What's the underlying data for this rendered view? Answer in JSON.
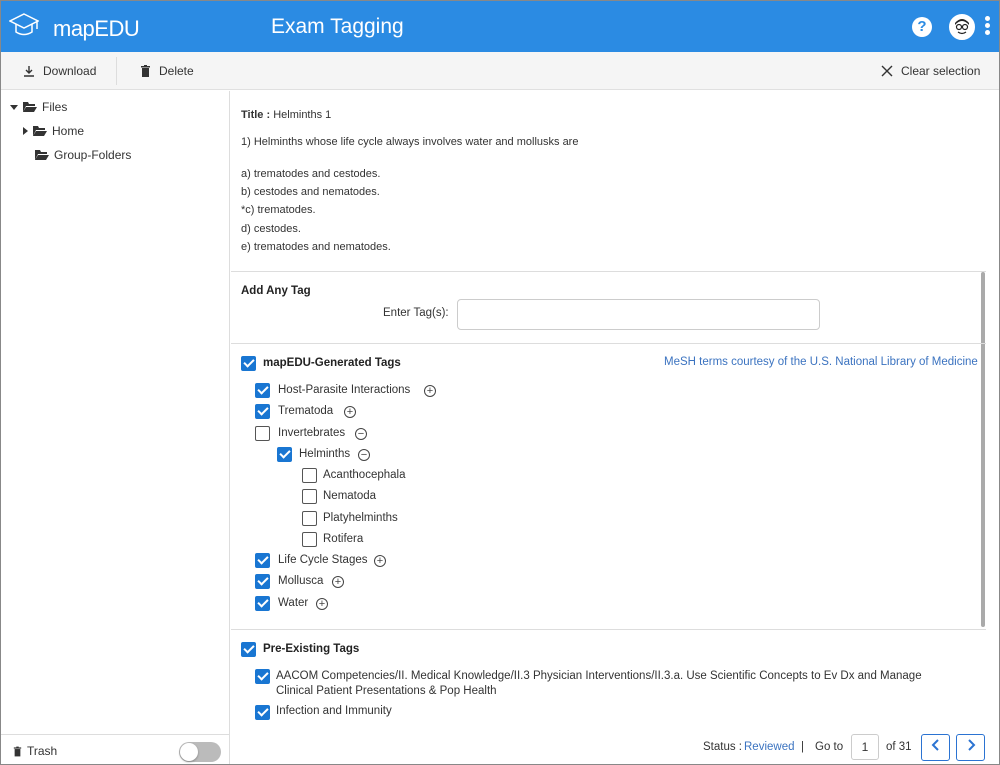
{
  "app": {
    "brand": "mapEDU",
    "title": "Exam Tagging",
    "help_label": "?"
  },
  "toolbar": {
    "download_label": "Download",
    "delete_label": "Delete",
    "clear_label": "Clear selection"
  },
  "sidebar": {
    "root_label": "Files",
    "items": [
      {
        "label": "Home"
      },
      {
        "label": "Group-Folders"
      }
    ],
    "trash_label": "Trash"
  },
  "question": {
    "title_label": "Title :",
    "title_value": "Helminths 1",
    "stem": "1) Helminths whose life cycle always involves water and mollusks are",
    "options": [
      "a) trematodes and cestodes.",
      "b) cestodes and nematodes.",
      "*c) trematodes.",
      "d) cestodes.",
      "e) trematodes and nematodes."
    ]
  },
  "add_tag": {
    "heading": "Add Any Tag",
    "label": "Enter Tag(s):",
    "value": ""
  },
  "generated": {
    "heading": "mapEDU-Generated Tags",
    "mesh_credit": "MeSH terms courtesy of the U.S. National Library of Medicine",
    "tags": [
      {
        "label": "Host-Parasite Interactions",
        "checked": true,
        "expander": "+"
      },
      {
        "label": "Trematoda",
        "checked": true,
        "expander": "+"
      },
      {
        "label": "Invertebrates",
        "checked": false,
        "expander": "−"
      },
      {
        "label": "Helminths",
        "checked": true,
        "expander": "−"
      },
      {
        "label": "Acanthocephala",
        "checked": false,
        "expander": ""
      },
      {
        "label": "Nematoda",
        "checked": false,
        "expander": ""
      },
      {
        "label": "Platyhelminths",
        "checked": false,
        "expander": ""
      },
      {
        "label": "Rotifera",
        "checked": false,
        "expander": ""
      },
      {
        "label": "Life Cycle Stages",
        "checked": true,
        "expander": "+"
      },
      {
        "label": "Mollusca",
        "checked": true,
        "expander": "+"
      },
      {
        "label": "Water",
        "checked": true,
        "expander": "+"
      }
    ]
  },
  "preexisting": {
    "heading": "Pre-Existing Tags",
    "tags": [
      {
        "line1": "AACOM Competencies/II. Medical Knowledge/II.3 Physician Interventions/II.3.a. Use Scientific Concepts to Ev Dx and Manage",
        "line2": "Clinical Patient Presentations & Pop Health",
        "checked": true
      },
      {
        "line1": "Infection and Immunity",
        "line2": "",
        "checked": true
      }
    ]
  },
  "footer": {
    "status_label": "Status :",
    "status_value": "Reviewed",
    "separator": "|",
    "goto_label": "Go to",
    "page": "1",
    "of_label": "of 31"
  },
  "colors": {
    "appbar": "#2b8be3",
    "checkbox": "#1976d2",
    "link": "#3b73c0"
  }
}
